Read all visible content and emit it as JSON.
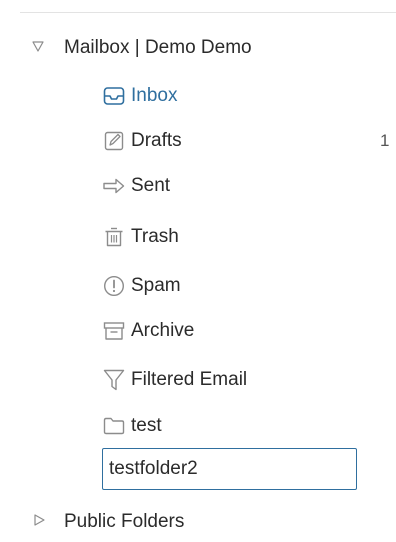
{
  "mailbox": {
    "label": "Mailbox | Demo Demo",
    "expanded": true,
    "folders": [
      {
        "label": "Inbox",
        "icon": "inbox-icon",
        "active": true
      },
      {
        "label": "Drafts",
        "icon": "drafts-icon",
        "count": "1"
      },
      {
        "label": "Sent",
        "icon": "sent-icon"
      },
      {
        "label": "Trash",
        "icon": "trash-icon"
      },
      {
        "label": "Spam",
        "icon": "spam-icon"
      },
      {
        "label": "Archive",
        "icon": "archive-icon"
      },
      {
        "label": "Filtered Email",
        "icon": "filter-icon"
      },
      {
        "label": "test",
        "icon": "folder-icon"
      }
    ],
    "new_folder_input_value": "testfolder2"
  },
  "public_folders": {
    "label": "Public Folders",
    "expanded": false
  },
  "colors": {
    "active": "#2f6f9f",
    "text": "#2b2b2b",
    "icon": "#8c8c8c"
  }
}
